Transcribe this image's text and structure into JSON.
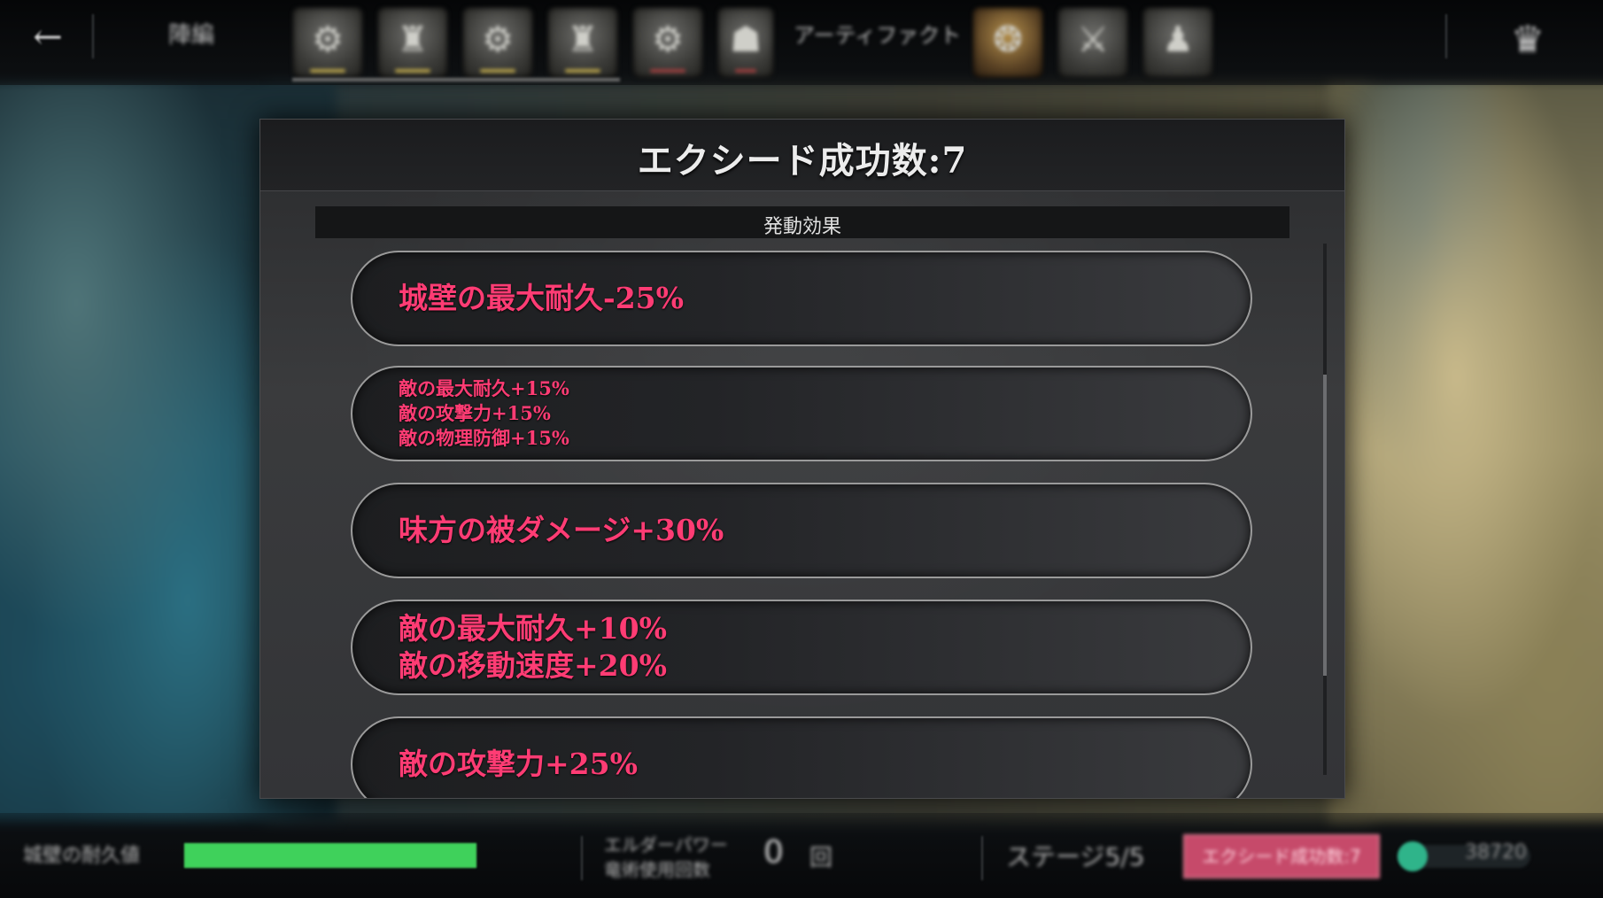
{
  "topbar": {
    "back_icon": "arrow-left-icon",
    "tab_label": "陣編",
    "artifact_label": "アーティファクト",
    "unit_slots": [
      "unit-slot-1",
      "unit-slot-2",
      "unit-slot-3",
      "unit-slot-4",
      "unit-slot-5",
      "unit-slot-6"
    ],
    "artifact_slots": [
      "artifact-slot-1",
      "artifact-slot-2",
      "artifact-slot-3"
    ],
    "crown_icon": "crown-icon"
  },
  "modal": {
    "title": "エクシード成功数:7",
    "section_title": "発動効果",
    "effects": [
      {
        "size": "lg",
        "lines": [
          "城壁の最大耐久-25%"
        ]
      },
      {
        "size": "sm",
        "lines": [
          "敵の最大耐久+15%",
          "敵の攻撃力+15%",
          "敵の物理防御+15%"
        ]
      },
      {
        "size": "lg",
        "lines": [
          "味方の被ダメージ+30%"
        ]
      },
      {
        "size": "lg",
        "lines": [
          "敵の最大耐久+10%",
          "敵の移動速度+20%"
        ]
      },
      {
        "size": "lg",
        "lines": [
          "敵の攻撃力+25%"
        ]
      }
    ],
    "effect_color": "#ff3c74"
  },
  "bottombar": {
    "castle_label": "城壁の耐久値",
    "castle_hp_fraction": 1.0,
    "hp_color": "#3fd15b",
    "elder_label_1": "エルダーパワー",
    "elder_label_2": "竜術使用回数",
    "elder_count": "0",
    "elder_unit": "回",
    "stage_label": "ステージ5/5",
    "exceed_button": "エクシード成功数:7",
    "speed_value": "38720"
  }
}
